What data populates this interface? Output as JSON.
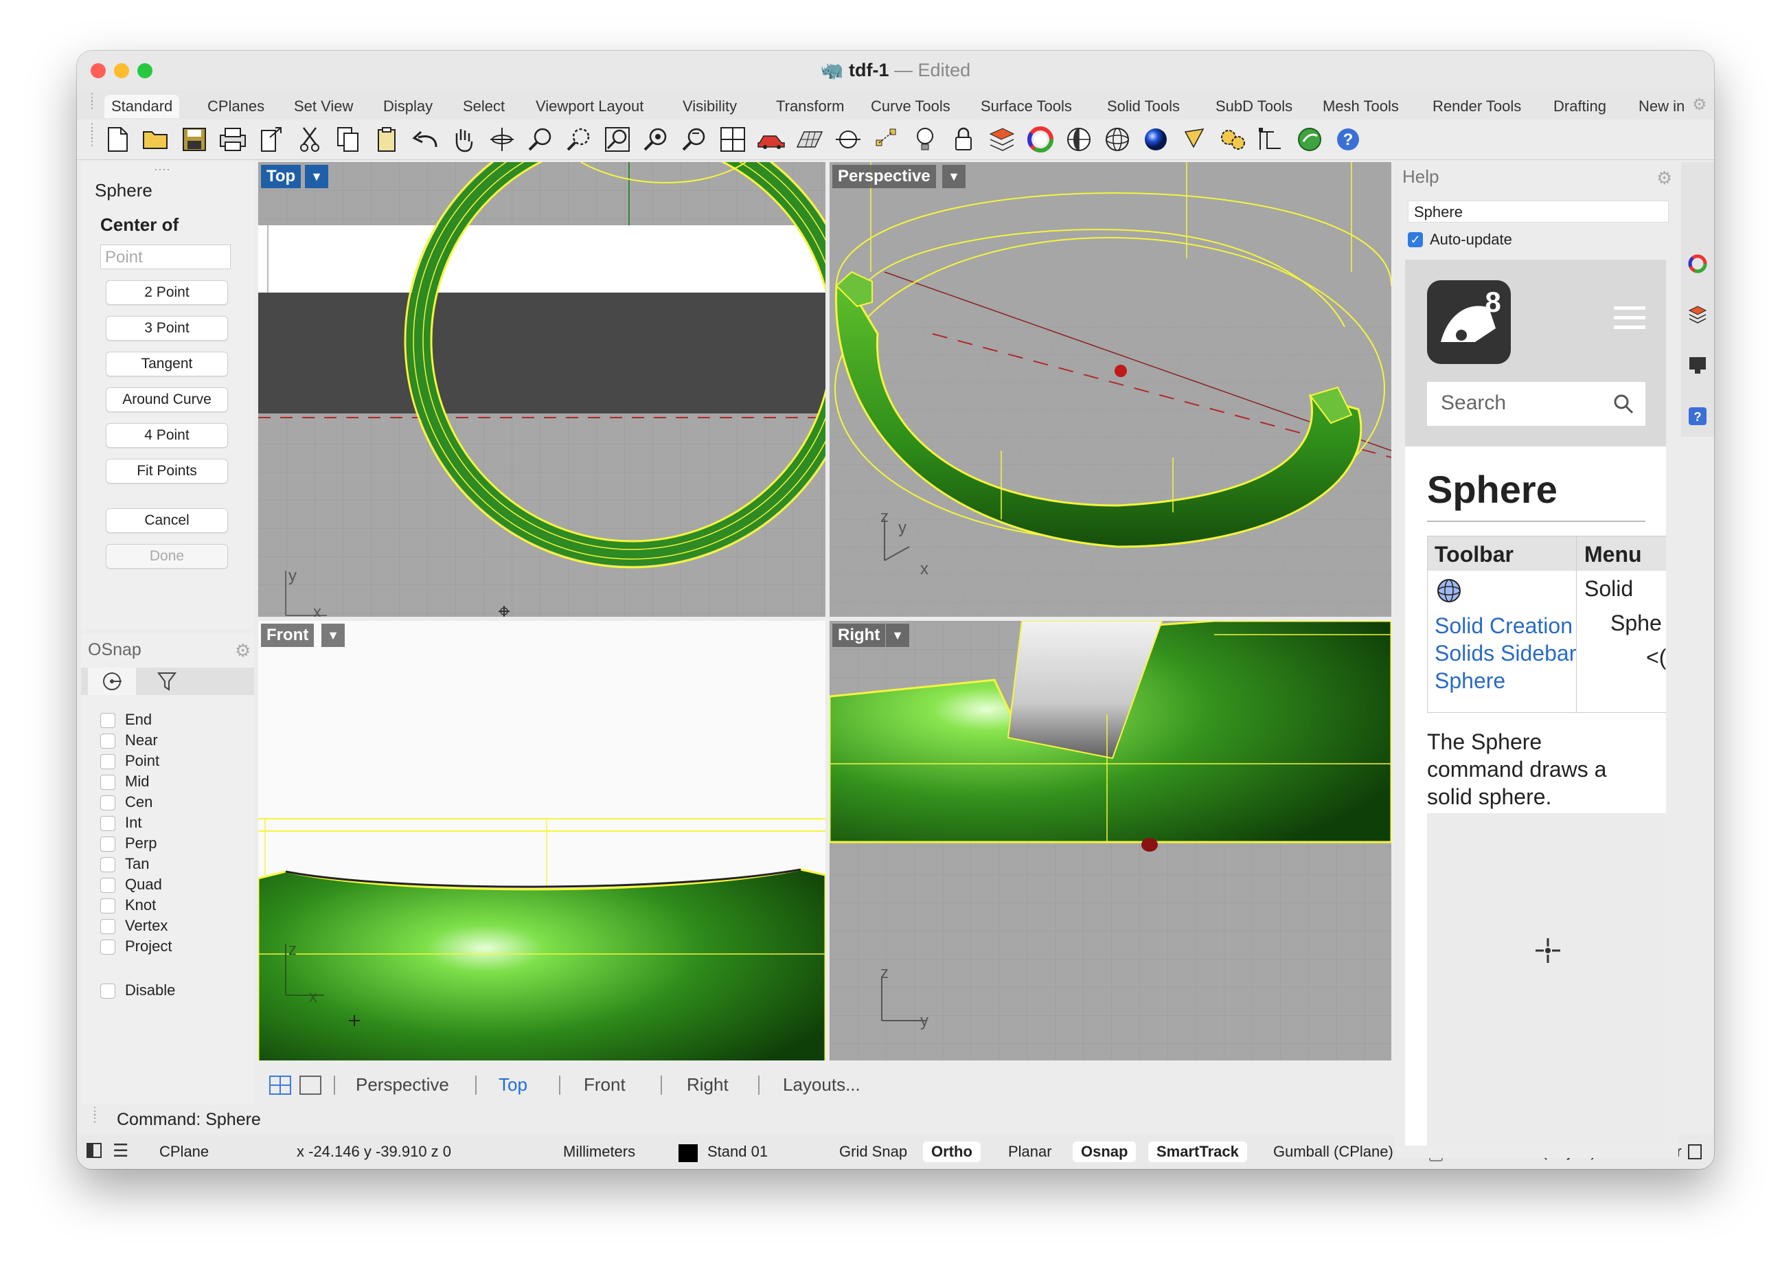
{
  "window": {
    "title": "tdf-1",
    "separator": "—",
    "subtitle": "Edited"
  },
  "tabs": [
    "Standard",
    "CPlanes",
    "Set View",
    "Display",
    "Select",
    "Viewport Layout",
    "Visibility",
    "Transform",
    "Curve Tools",
    "Surface Tools",
    "Solid Tools",
    "SubD Tools",
    "Mesh Tools",
    "Render Tools",
    "Drafting",
    "New in"
  ],
  "command_panel": {
    "title": "Sphere",
    "prompt": "Center of",
    "input_placeholder": "Point",
    "options": [
      "2 Point",
      "3 Point",
      "Tangent",
      "Around Curve",
      "4 Point",
      "Fit Points"
    ],
    "cancel": "Cancel",
    "done": "Done"
  },
  "osnap": {
    "title": "OSnap",
    "items": [
      "End",
      "Near",
      "Point",
      "Mid",
      "Cen",
      "Int",
      "Perp",
      "Tan",
      "Quad",
      "Knot",
      "Vertex",
      "Project"
    ],
    "disable": "Disable"
  },
  "viewports": {
    "top": "Top",
    "perspective": "Perspective",
    "front": "Front",
    "right": "Right"
  },
  "axes": {
    "x": "x",
    "y": "y",
    "z": "z"
  },
  "viewport_tabs": {
    "perspective": "Perspective",
    "top": "Top",
    "front": "Front",
    "right": "Right",
    "layouts": "Layouts..."
  },
  "command_line": "Command: Sphere",
  "status": {
    "cplane": "CPlane",
    "coords": "x -24.146  y -39.910  z 0",
    "units": "Millimeters",
    "layer": "Stand 01",
    "grid_snap": "Grid Snap",
    "ortho": "Ortho",
    "planar": "Planar",
    "osnap": "Osnap",
    "smarttrack": "SmartTrack",
    "gumball": "Gumball (CPlane)",
    "autocplane": "Auto CPlane (Object)",
    "record": "Recor"
  },
  "help": {
    "title": "Help",
    "field_value": "Sphere",
    "auto_update": "Auto-update",
    "search_placeholder": "Search",
    "heading": "Sphere",
    "table_headers": [
      "Toolbar",
      "Menu"
    ],
    "links": [
      "Solid Creation",
      "Solids Sidebar",
      "Sphere"
    ],
    "menu_items": [
      "Solid",
      "Sphe",
      "<("
    ],
    "description": "The Sphere command draws a solid sphere.",
    "logo_num": "8"
  },
  "colors": {
    "accent": "#1f5fa8",
    "green": "#3f9e1f",
    "wire": "#f5f53c"
  }
}
